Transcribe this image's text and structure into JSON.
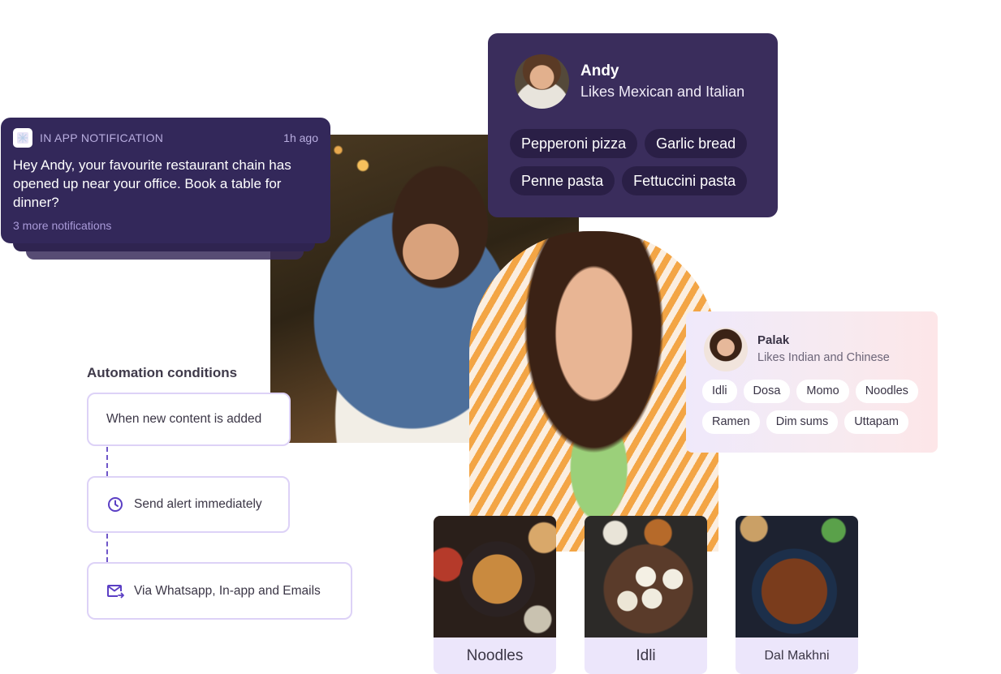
{
  "notification": {
    "kind": "IN APP NOTIFICATION",
    "time": "1h ago",
    "message": "Hey Andy, your favourite restaurant chain has opened up near your office. Book a table for dinner?",
    "more": "3 more notifications"
  },
  "andy": {
    "name": "Andy",
    "likes": "Likes Mexican and Italian",
    "dishes": [
      "Pepperoni pizza",
      "Garlic bread",
      "Penne pasta",
      "Fettuccini pasta"
    ]
  },
  "palak": {
    "name": "Palak",
    "likes": "Likes Indian and Chinese",
    "dishes": [
      "Idli",
      "Dosa",
      "Momo",
      "Noodles",
      "Ramen",
      "Dim sums",
      "Uttapam"
    ]
  },
  "automation": {
    "title": "Automation conditions",
    "steps": [
      {
        "label": "When new content is added",
        "icon": ""
      },
      {
        "label": "Send alert immediately",
        "icon": "clock-icon"
      },
      {
        "label": "Via Whatsapp, In-app and Emails",
        "icon": "mail-send-icon"
      }
    ]
  },
  "foods": [
    {
      "label": "Noodles"
    },
    {
      "label": "Idli"
    },
    {
      "label": "Dal Makhni"
    }
  ],
  "colors": {
    "dark_card": "#3a2d5c",
    "accent": "#6f56c9",
    "step_border": "#ddd2f7",
    "food_label_bg": "#ece6fb"
  }
}
